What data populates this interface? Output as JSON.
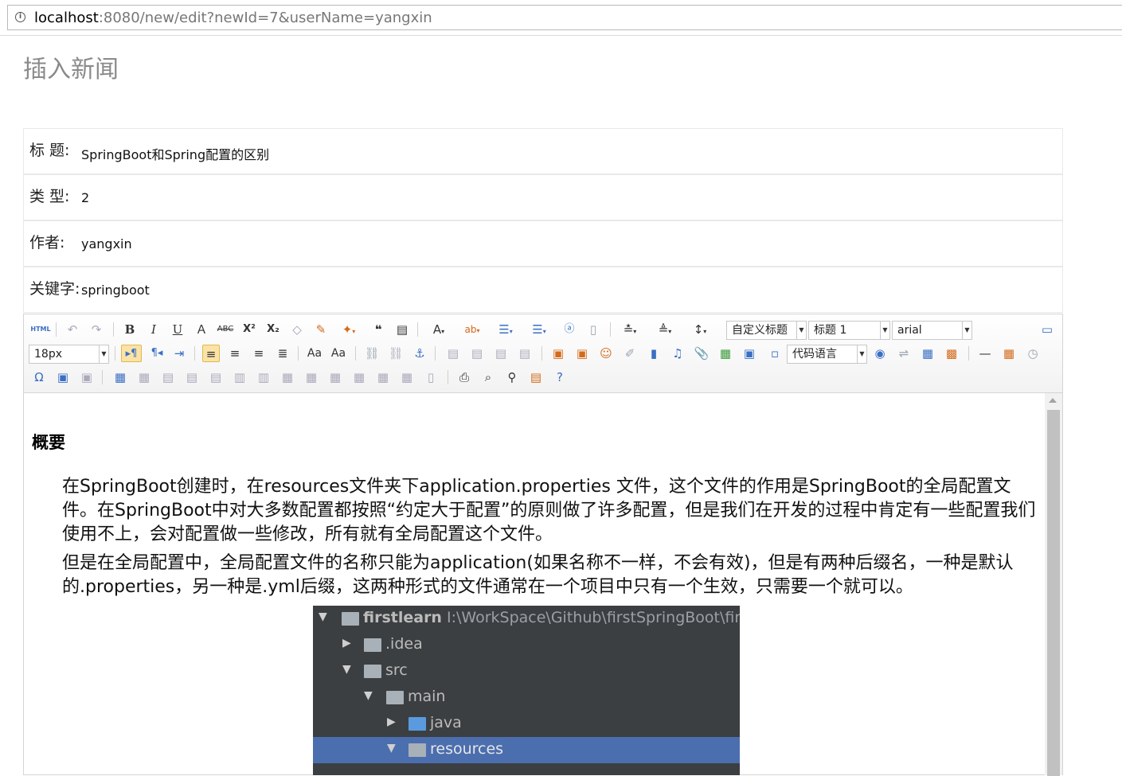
{
  "browser": {
    "url_host": "localhost",
    "url_rest": ":8080/new/edit?newId=7&userName=yangxin"
  },
  "page": {
    "title": "插入新闻"
  },
  "form": {
    "title_label": "标 题:",
    "title_value": "SpringBoot和Spring配置的区别",
    "type_label": "类 型:",
    "type_value": "2",
    "author_label": "作者:",
    "author_value": "yangxin",
    "keyword_label": "关键字:",
    "keyword_value": "springboot"
  },
  "toolbar": {
    "html_label": "HTML",
    "custom_heading": "自定义标题",
    "paragraph_format": "标题 1",
    "font_family": "arial",
    "font_size": "18px",
    "code_language": "代码语言"
  },
  "content": {
    "heading": "概要",
    "paragraph1": "在SpringBoot创建时，在resources文件夹下application.properties 文件，这个文件的作用是SpringBoot的全局配置文件。在SpringBoot中对大多数配置都按照“约定大于配置”的原则做了许多配置，但是我们在开发的过程中肯定有一些配置我们使用不上，会对配置做一些修改，所有就有全局配置这个文件。",
    "paragraph2": "但是在全局配置中，全局配置文件的名称只能为application(如果名称不一样，不会有效)，但是有两种后缀名，一种是默认的.properties，另一种是.yml后缀，这两种形式的文件通常在一个项目中只有一个生效，只需要一个就可以。",
    "tree": [
      {
        "name": "firstlearn",
        "path": "I:\\WorkSpace\\Github\\firstSpringBoot\\first"
      },
      {
        "name": ".idea"
      },
      {
        "name": "src"
      },
      {
        "name": "main"
      },
      {
        "name": "java"
      },
      {
        "name": "resources"
      }
    ]
  }
}
